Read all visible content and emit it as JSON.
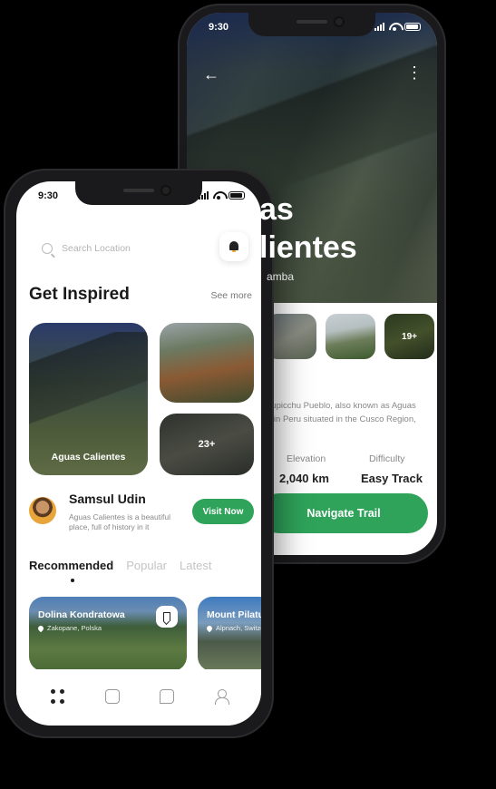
{
  "back_screen": {
    "status_time": "9:30",
    "title_line1": "as",
    "title_line2": "lientes",
    "subtitle": "amba",
    "thumb_count": "19+",
    "description": "hupicchu Pueblo, also known as Aguas\nn in Peru situated in the Cusco Region,",
    "stats": {
      "elevation_label": "Elevation",
      "elevation_value": "2,040 km",
      "difficulty_label": "Difficulty",
      "difficulty_value": "Easy Track"
    },
    "navigate_label": "Navigate Trail"
  },
  "front_screen": {
    "status_time": "9:30",
    "search": {
      "placeholder": "Search Location"
    },
    "section_title": "Get Inspired",
    "see_more": "See more",
    "featured": {
      "main_label": "Aguas Calientes",
      "more_count": "23+"
    },
    "guide": {
      "name": "Samsul Udin",
      "description": "Aguas Calientes is a beautiful place, full of history in it",
      "visit_label": "Visit Now"
    },
    "tabs": [
      "Recommended",
      "Popular",
      "Latest"
    ],
    "active_tab": "Recommended",
    "recommended": [
      {
        "title": "Dolina Kondratowa",
        "location": "Zakopane, Polska"
      },
      {
        "title": "Mount Pilatus",
        "location": "Alpnach, Switzerland"
      }
    ],
    "bottom_nav": [
      "home-icon",
      "chat-icon",
      "message-icon",
      "profile-icon"
    ]
  },
  "colors": {
    "accent_green": "#2fa35a",
    "text_dark": "#1a1a1a"
  }
}
